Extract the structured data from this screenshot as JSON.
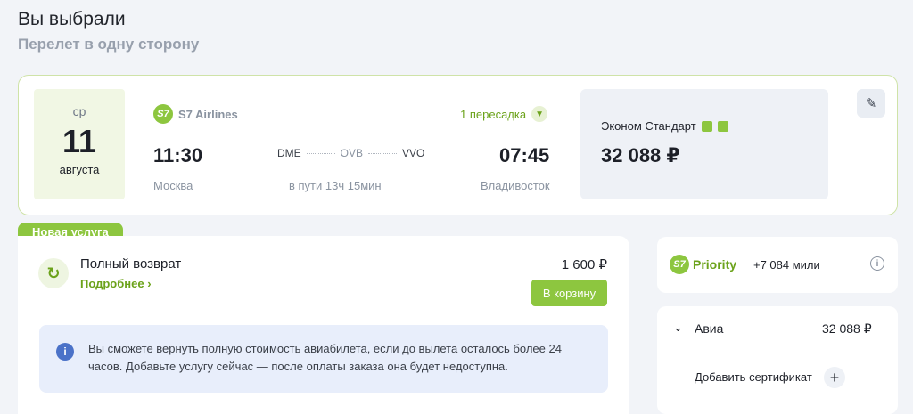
{
  "header": {
    "title": "Вы выбрали",
    "subtitle": "Перелет в одну сторону"
  },
  "flight": {
    "date": {
      "weekday": "ср",
      "day": "11",
      "month": "августа"
    },
    "airline_logo": "S7",
    "airline": "S7 Airlines",
    "transfers": "1 пересадка",
    "departure_time": "11:30",
    "arrival_time": "07:45",
    "route": {
      "from": "DME",
      "via": "OVB",
      "to": "VVO"
    },
    "departure_city": "Москва",
    "arrival_city": "Владивосток",
    "duration": "в пути 13ч 15мин",
    "fare": {
      "name": "Эконом Стандарт",
      "price": "32 088 ₽"
    },
    "edit_icon": "pencil-icon"
  },
  "service": {
    "badge": "Новая услуга",
    "name": "Полный возврат",
    "more": "Подробнее ›",
    "price": "1 600 ₽",
    "cart_button": "В корзину",
    "info_text": "Вы сможете вернуть полную стоимость авиабилета, если до вылета осталось более 24 часов. Добавьте услугу сейчас — после оплаты заказа она будет недоступна."
  },
  "priority": {
    "logo": "S7",
    "label": "Priority",
    "miles": "+7 084 мили"
  },
  "summary": {
    "label": "Авиа",
    "value": "32 088 ₽",
    "certificate": "Добавить сертификат"
  },
  "colors": {
    "accent": "#8dc63f",
    "accent_text": "#6ba21a",
    "info_bg": "#e8eefb"
  }
}
